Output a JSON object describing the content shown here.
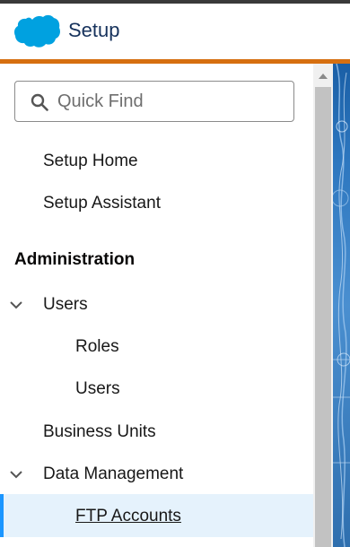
{
  "header": {
    "title": "Setup"
  },
  "colors": {
    "brand_blue": "#00a1e0",
    "accent_orange": "#d66f10",
    "selected_bg": "#e5f2fc",
    "selected_bar": "#1b96ff"
  },
  "search": {
    "placeholder": "Quick Find",
    "value": ""
  },
  "nav": {
    "setup_home": "Setup Home",
    "setup_assistant": "Setup Assistant",
    "administration_heading": "Administration",
    "users_group": "Users",
    "roles": "Roles",
    "users": "Users",
    "business_units": "Business Units",
    "data_management_group": "Data Management",
    "ftp_accounts": "FTP Accounts"
  }
}
